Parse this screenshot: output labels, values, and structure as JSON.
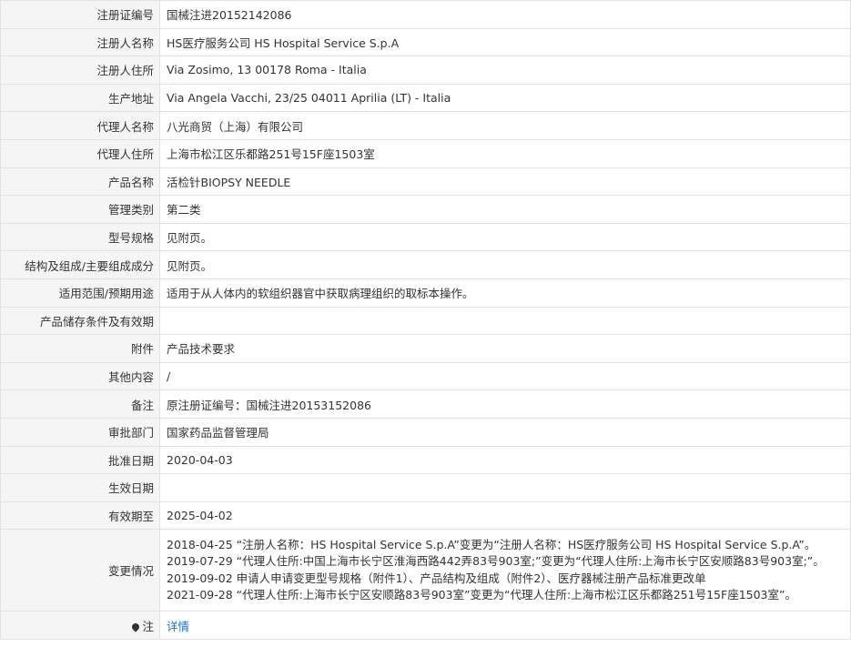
{
  "rows": [
    {
      "label": "注册证编号",
      "value": "国械注进20152142086"
    },
    {
      "label": "注册人名称",
      "value": "HS医疗服务公司 HS Hospital Service S.p.A"
    },
    {
      "label": "注册人住所",
      "value": "Via Zosimo, 13 00178 Roma - Italia"
    },
    {
      "label": "生产地址",
      "value": "Via Angela Vacchi, 23/25 04011 Aprilia (LT) - Italia"
    },
    {
      "label": "代理人名称",
      "value": "八光商贸（上海）有限公司"
    },
    {
      "label": "代理人住所",
      "value": "上海市松江区乐都路251号15F座1503室"
    },
    {
      "label": "产品名称",
      "value": "活检针BIOPSY NEEDLE"
    },
    {
      "label": "管理类别",
      "value": "第二类"
    },
    {
      "label": "型号规格",
      "value": "见附页。"
    },
    {
      "label": "结构及组成/主要组成成分",
      "value": "见附页。"
    },
    {
      "label": "适用范围/预期用途",
      "value": "适用于从人体内的软组织器官中获取病理组织的取标本操作。"
    },
    {
      "label": "产品储存条件及有效期",
      "value": ""
    },
    {
      "label": "附件",
      "value": "产品技术要求"
    },
    {
      "label": "其他内容",
      "value": "/"
    },
    {
      "label": "备注",
      "value": "原注册证编号：国械注进20153152086"
    },
    {
      "label": "审批部门",
      "value": "国家药品监督管理局"
    },
    {
      "label": "批准日期",
      "value": "2020-04-03"
    },
    {
      "label": "生效日期",
      "value": ""
    },
    {
      "label": "有效期至",
      "value": "2025-04-02"
    }
  ],
  "changes": {
    "label": "变更情况",
    "lines": [
      "2018-04-25 “注册人名称：HS Hospital Service S.p.A”变更为“注册人名称：HS医疗服务公司 HS Hospital Service S.p.A”。",
      "2019-07-29 “代理人住所:中国上海市长宁区淮海西路442弄83号903室;”变更为“代理人住所:上海市长宁区安顺路83号903室;”。",
      "2019-09-02 申请人申请变更型号规格（附件1）、产品结构及组成（附件2）、医疗器械注册产品标准更改单",
      "2021-09-28 “代理人住所:上海市长宁区安顺路83号903室”变更为“代理人住所:上海市松江区乐都路251号15F座1503室”。"
    ]
  },
  "note": {
    "icon": "map-pin-icon",
    "label": "注",
    "link_text": "详情",
    "link_color": "#1a6fc4"
  }
}
